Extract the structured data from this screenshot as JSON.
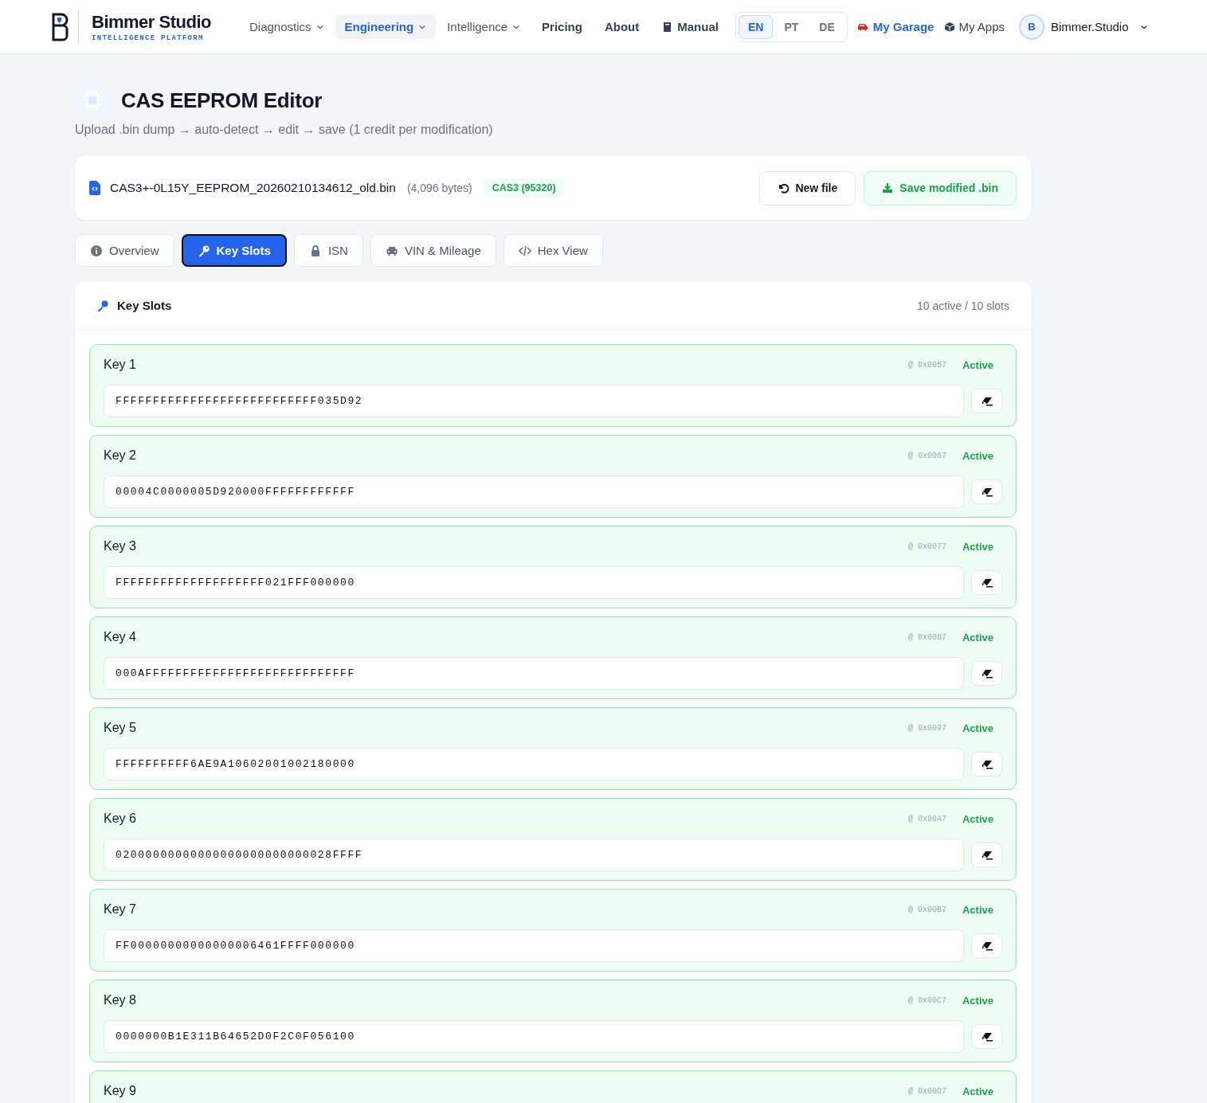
{
  "brand": {
    "name": "Bimmer Studio",
    "tagline": "INTELLIGENCE PLATFORM"
  },
  "nav": [
    {
      "label": "Diagnostics",
      "kind": "menu",
      "selected": false
    },
    {
      "label": "Engineering",
      "kind": "menu",
      "selected": true
    },
    {
      "label": "Intelligence",
      "kind": "menu",
      "selected": false
    },
    {
      "label": "Pricing",
      "kind": "link",
      "selected": false
    },
    {
      "label": "About",
      "kind": "link",
      "selected": false
    },
    {
      "label": "Manual",
      "kind": "manual",
      "selected": false
    }
  ],
  "languages": [
    {
      "label": "EN",
      "selected": true
    },
    {
      "label": "PT",
      "selected": false
    },
    {
      "label": "DE",
      "selected": false
    }
  ],
  "my_garage": "My Garage",
  "my_apps": "My Apps",
  "user": {
    "initial": "B",
    "name": "Bimmer.Studio"
  },
  "page": {
    "title": "CAS EEPROM Editor",
    "subtitle": "Upload .bin dump → auto-detect → edit → save (1 credit per modification)"
  },
  "file": {
    "name": "CAS3+-0L15Y_EEPROM_20260210134612_old.bin",
    "size": "(4,096 bytes)",
    "badge": "CAS3 (95320)",
    "buttons": [
      {
        "label": "New file",
        "kind": "reset"
      },
      {
        "label": "Save modified .bin",
        "kind": "save"
      }
    ]
  },
  "tabs": [
    {
      "label": "Overview",
      "selected": false
    },
    {
      "label": "Key Slots",
      "selected": true
    },
    {
      "label": "ISN",
      "selected": false
    },
    {
      "label": "VIN & Mileage",
      "selected": false
    },
    {
      "label": "Hex View",
      "selected": false
    }
  ],
  "panel": {
    "title": "Key Slots",
    "summary": "10 active / 10 slots",
    "keys": [
      {
        "name": "Key 1",
        "offset": "@ 0x0057",
        "status": "Active",
        "active": true,
        "value": "FFFFFFFFFFFFFFFFFFFFFFFFFFF035D92"
      },
      {
        "name": "Key 2",
        "offset": "@ 0x0067",
        "status": "Active",
        "active": true,
        "value": "00004C0000005D920000FFFFFFFFFFFF"
      },
      {
        "name": "Key 3",
        "offset": "@ 0x0077",
        "status": "Active",
        "active": true,
        "value": "FFFFFFFFFFFFFFFFFFFF021FFF000000"
      },
      {
        "name": "Key 4",
        "offset": "@ 0x0087",
        "status": "Active",
        "active": true,
        "value": "000AFFFFFFFFFFFFFFFFFFFFFFFFFFFF"
      },
      {
        "name": "Key 5",
        "offset": "@ 0x0097",
        "status": "Active",
        "active": true,
        "value": "FFFFFFFFFF6AE9A10602001002180000"
      },
      {
        "name": "Key 6",
        "offset": "@ 0x00A7",
        "status": "Active",
        "active": true,
        "value": "02000000000000000000000000028FFFF"
      },
      {
        "name": "Key 7",
        "offset": "@ 0x00B7",
        "status": "Active",
        "active": true,
        "value": "FF00000000000000006461FFFF000000"
      },
      {
        "name": "Key 8",
        "offset": "@ 0x00C7",
        "status": "Active",
        "active": true,
        "value": "0000000B1E311B64652D0F2C0F056100"
      },
      {
        "name": "Key 9",
        "offset": "@ 0x00D7",
        "status": "Active",
        "active": true
      }
    ]
  }
}
